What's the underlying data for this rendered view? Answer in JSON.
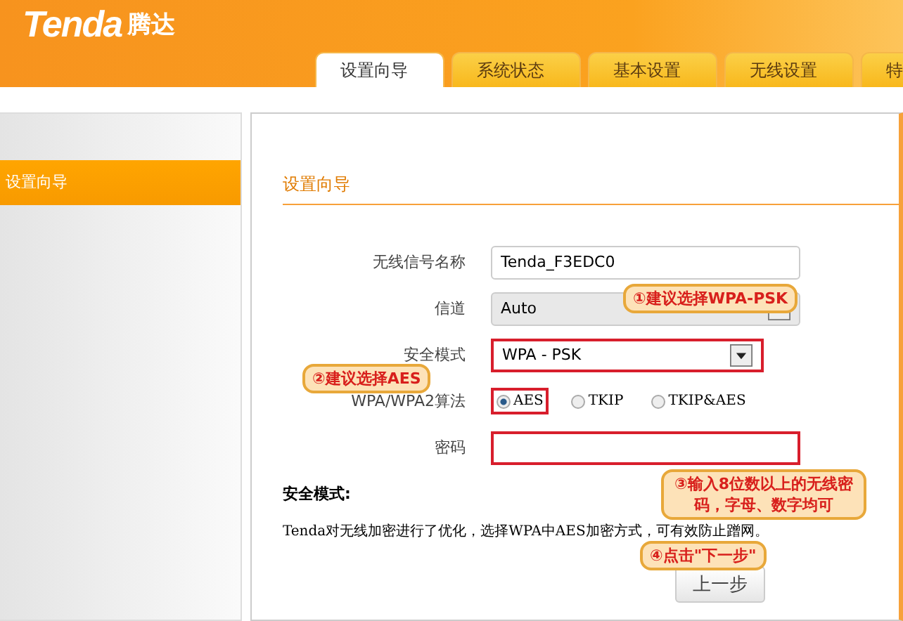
{
  "header": {
    "logo": "Tenda",
    "logo_cn": "腾达"
  },
  "tabs": [
    {
      "label": "设置向导",
      "selected": true
    },
    {
      "label": "系统状态",
      "selected": false
    },
    {
      "label": "基本设置",
      "selected": false
    },
    {
      "label": "无线设置",
      "selected": false
    },
    {
      "label": "特",
      "selected": false
    }
  ],
  "sidebar": {
    "items": [
      {
        "label": "设置向导",
        "selected": true
      }
    ]
  },
  "panel": {
    "title": "设置向导",
    "fields": [
      {
        "kind": "text",
        "label": "无线信号名称",
        "value": "Tenda_F3EDC0",
        "highlighted": false
      },
      {
        "kind": "select",
        "label": "信道",
        "value": "Auto",
        "disabled": true,
        "highlighted": false
      },
      {
        "kind": "select",
        "label": "安全模式",
        "value": "WPA - PSK",
        "disabled": false,
        "highlighted": true
      },
      {
        "kind": "radio",
        "label": "WPA/WPA2算法",
        "options": [
          {
            "label": "AES",
            "selected": true,
            "highlighted": true
          },
          {
            "label": "TKIP",
            "selected": false,
            "highlighted": false
          },
          {
            "label": "TKIP&AES",
            "selected": false,
            "highlighted": false
          }
        ]
      },
      {
        "kind": "password",
        "label": "密码",
        "highlighted": true
      }
    ],
    "note_title": "安全模式:",
    "note": "Tenda对无线加密进行了优化，选择WPA中AES加密方式，可有效防止蹭网。",
    "buttons": [
      "上一步"
    ]
  },
  "callouts": [
    {
      "text": "①建议选择WPA-PSK"
    },
    {
      "text": "②建议选择AES"
    },
    {
      "text": "③输入8位数以上的无线密码，字母、数字均可"
    },
    {
      "text": "④点击\"下一步\""
    }
  ]
}
